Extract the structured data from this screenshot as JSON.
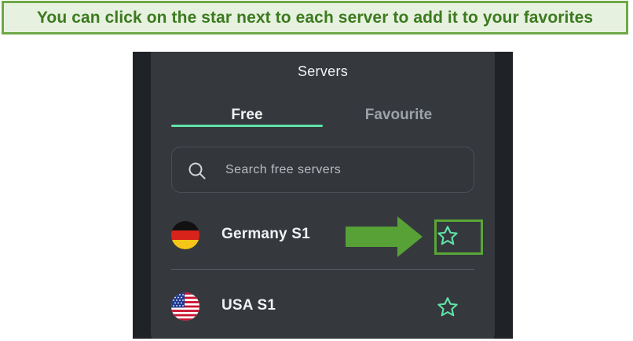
{
  "callout": {
    "text": "You can click on the star next to each server to add it to your favorites"
  },
  "panel": {
    "title": "Servers"
  },
  "tabs": [
    {
      "label": "Free",
      "active": true
    },
    {
      "label": "Favourite",
      "active": false
    }
  ],
  "search": {
    "placeholder": "Search free servers",
    "value": "",
    "icon": "search-icon"
  },
  "servers": [
    {
      "name": "Germany S1",
      "flag": "germany-flag-icon",
      "favorite_icon": "star-outline-icon"
    },
    {
      "name": "USA S1",
      "flag": "usa-flag-icon",
      "favorite_icon": "star-outline-icon"
    }
  ],
  "colors": {
    "accent": "#5fe3a8",
    "callout_border": "#6fa847",
    "callout_text": "#3c7a1f",
    "panel_background": "#35393e",
    "annotation_green": "#5aa637"
  }
}
